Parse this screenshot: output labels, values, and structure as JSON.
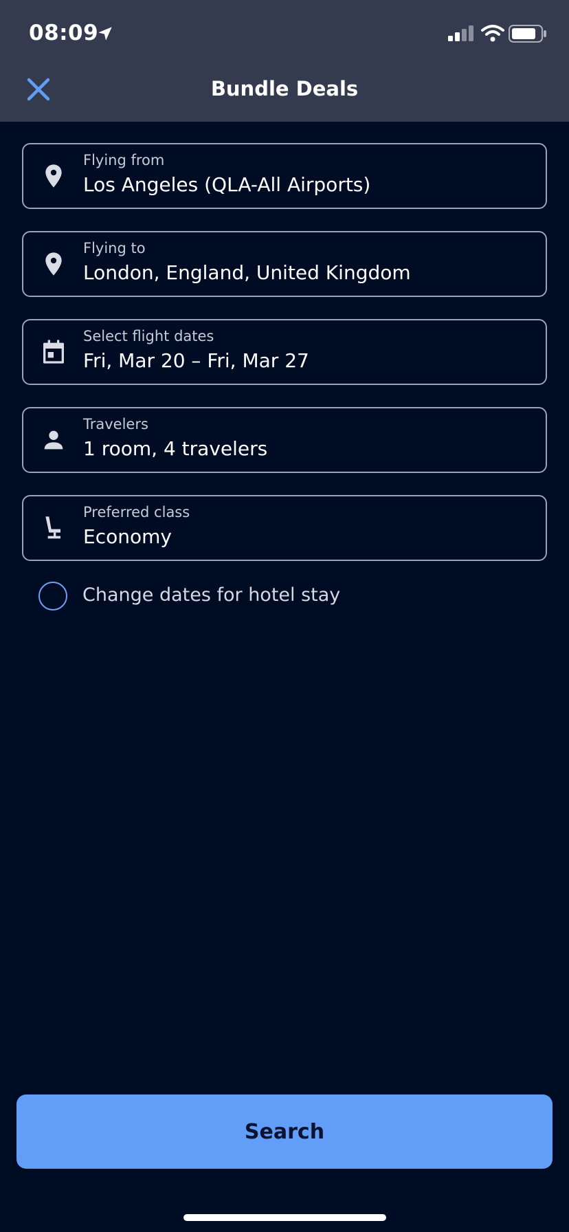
{
  "status_bar": {
    "time": "08:09"
  },
  "header": {
    "title": "Bundle Deals"
  },
  "fields": [
    {
      "label": "Flying from",
      "value": "Los Angeles (QLA-All Airports)",
      "icon": "location-pin-icon"
    },
    {
      "label": "Flying to",
      "value": "London, England, United Kingdom",
      "icon": "location-pin-icon"
    },
    {
      "label": "Select flight dates",
      "value": "Fri, Mar 20 – Fri, Mar 27",
      "icon": "calendar-icon"
    },
    {
      "label": "Travelers",
      "value": "1 room, 4 travelers",
      "icon": "person-icon"
    },
    {
      "label": "Preferred class",
      "value": "Economy",
      "icon": "seat-icon"
    }
  ],
  "hotel_dates_option": {
    "label": "Change dates for hotel stay",
    "checked": false
  },
  "search_button": {
    "label": "Search"
  },
  "colors": {
    "background": "#000b24",
    "header": "#353b4e",
    "accent": "#629ef8",
    "field_border": "#9aa3b8"
  }
}
